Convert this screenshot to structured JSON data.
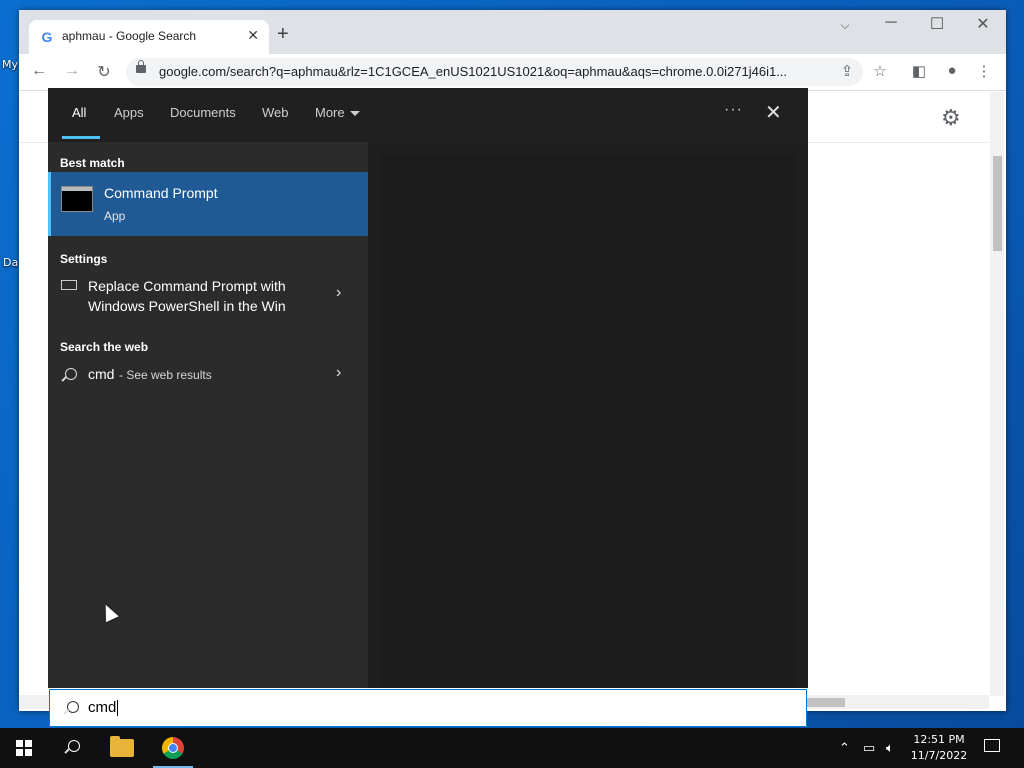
{
  "desktop": {
    "icon_labels": [
      "My",
      "Da"
    ]
  },
  "browser": {
    "tab_title": "aphmau - Google Search",
    "favicon": "G",
    "url": "google.com/search?q=aphmau&rlz=1C1GCEA_enUS1021US1021&oq=aphmau&aqs=chrome.0.0i271j46i1..."
  },
  "search_panel": {
    "filters": [
      "All",
      "Apps",
      "Documents",
      "Web",
      "More"
    ],
    "active_filter": "All",
    "sections": {
      "best_match": "Best match",
      "settings": "Settings",
      "search_web": "Search the web"
    },
    "best_match_item": {
      "name": "Command Prompt",
      "kind": "App"
    },
    "settings_item": {
      "line1": "Replace Command Prompt with",
      "line2": "Windows PowerShell in the Win"
    },
    "web_item": {
      "query": "cmd",
      "suffix": "- See web results"
    },
    "query": "cmd"
  },
  "taskbar": {
    "time": "12:51 PM",
    "date": "11/7/2022"
  },
  "colors": {
    "accent": "#4cc2ff",
    "selected": "#1f5a94"
  }
}
